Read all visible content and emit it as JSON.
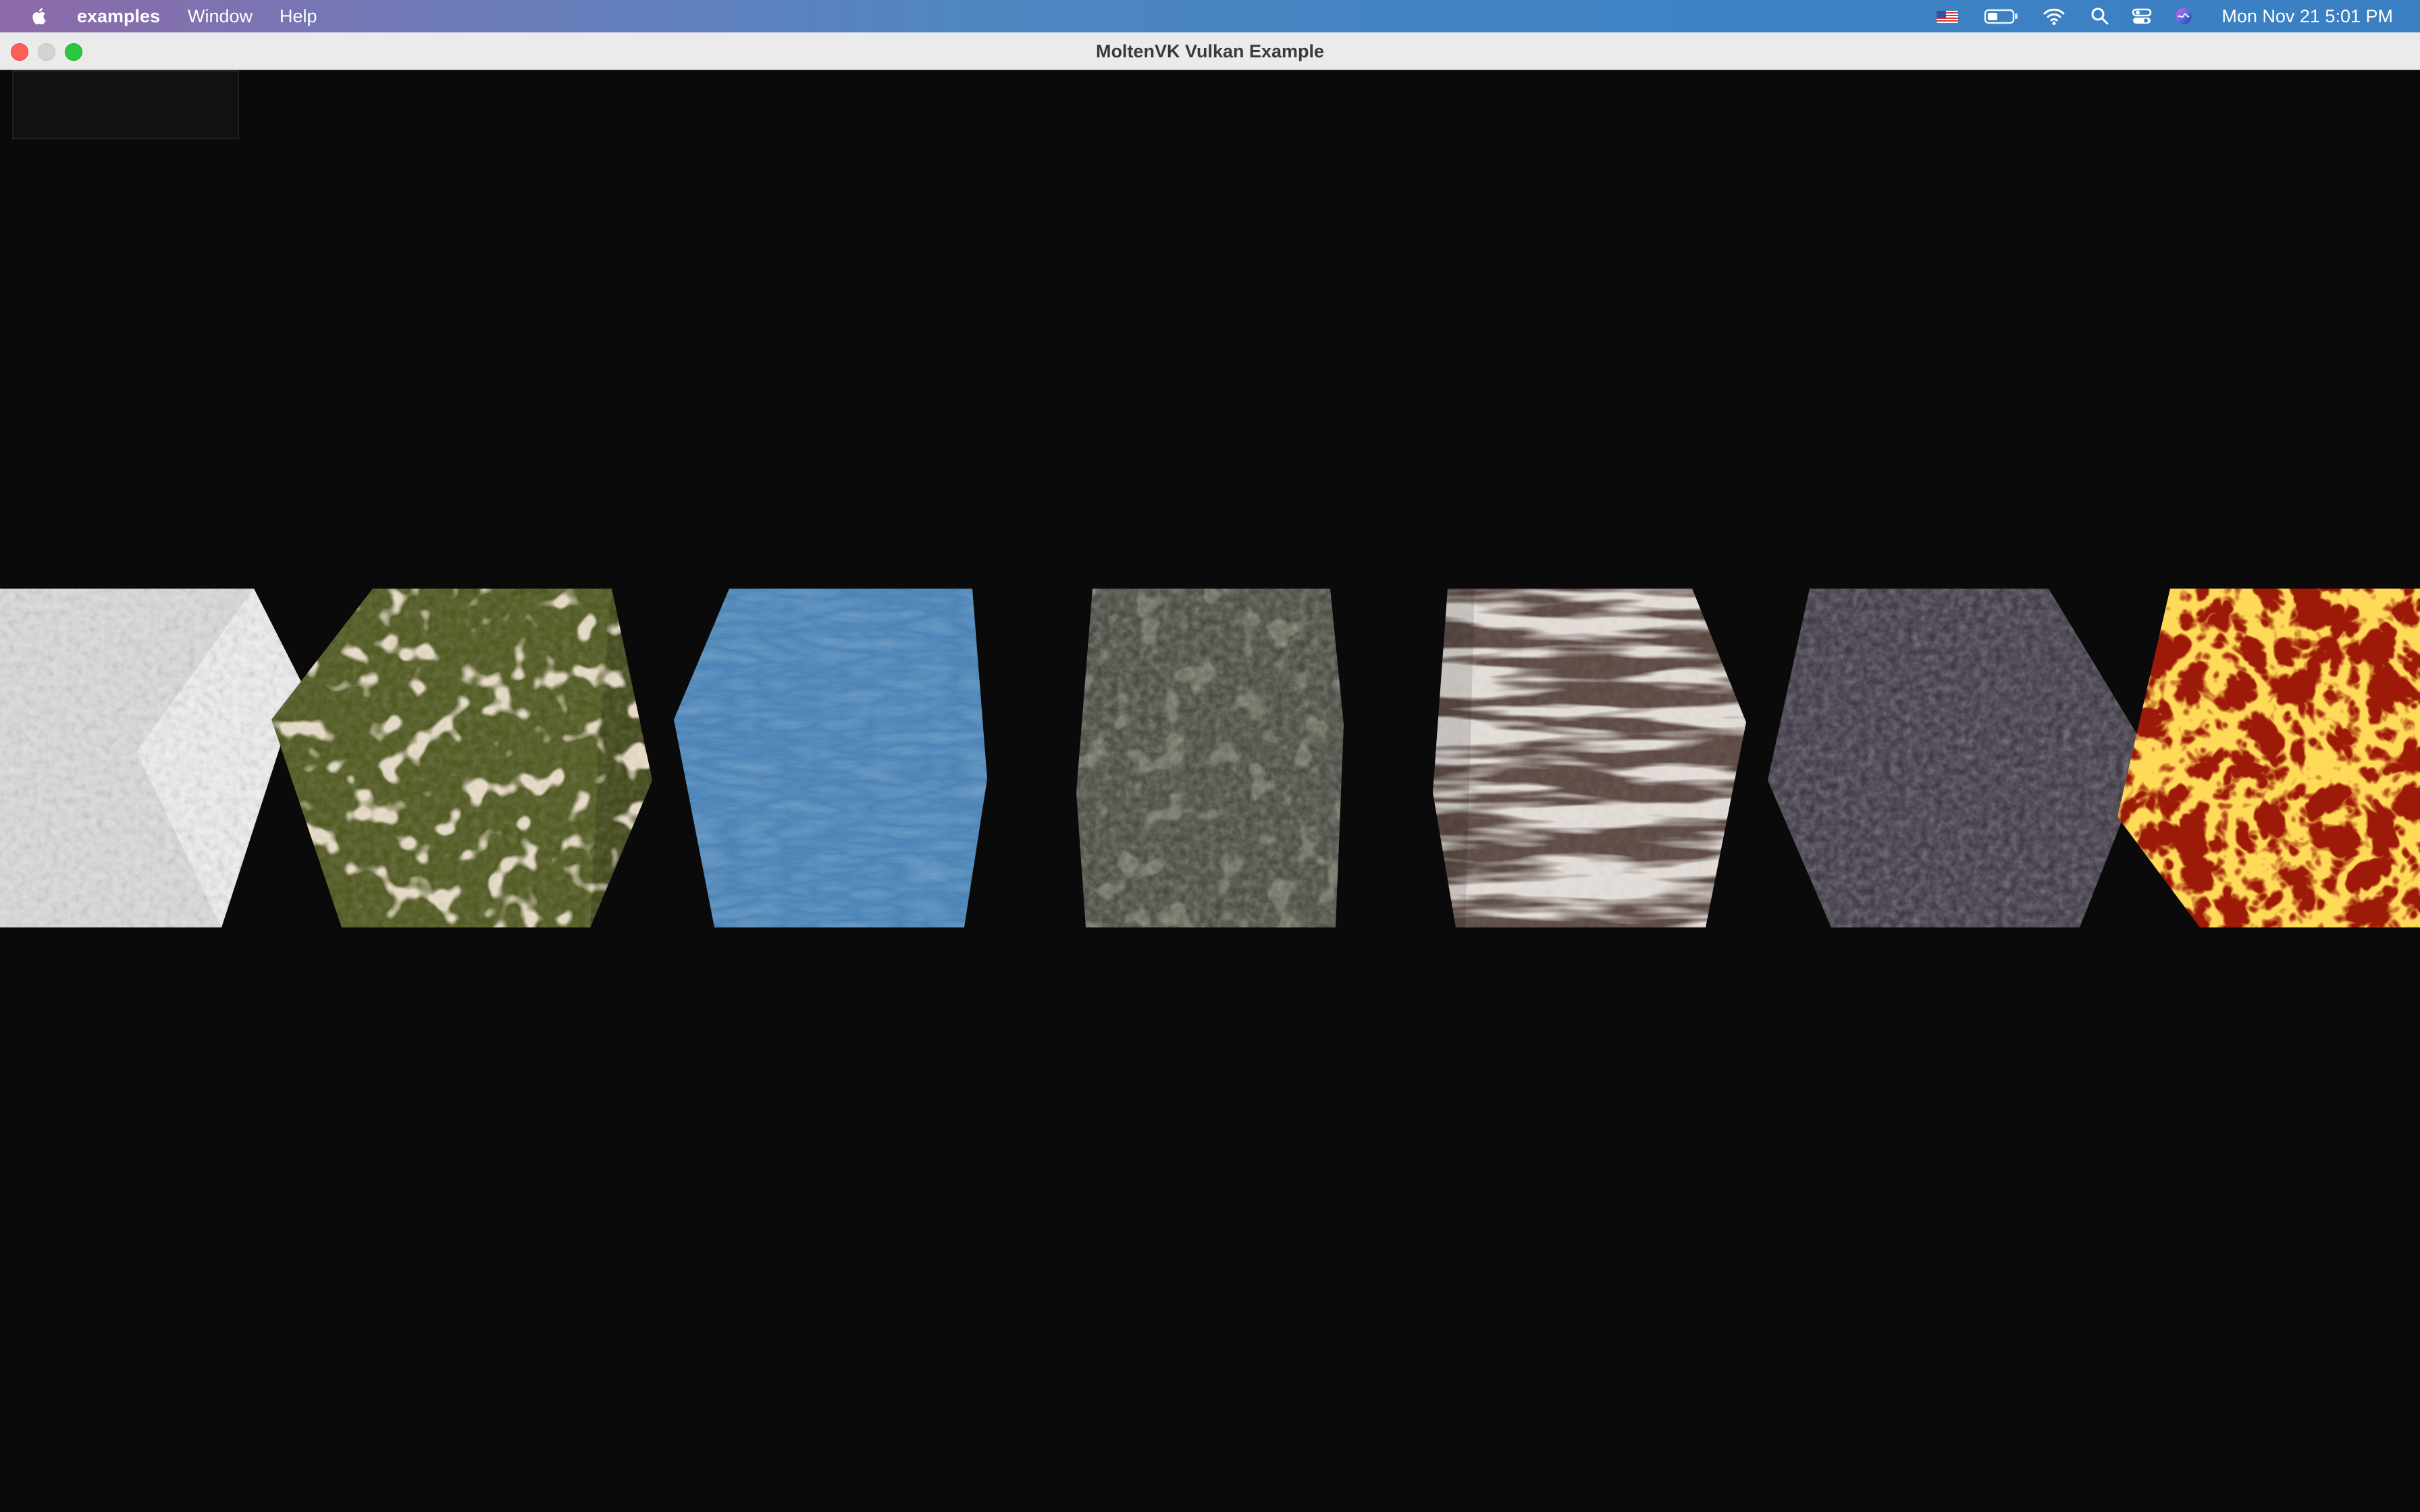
{
  "menubar": {
    "apple_icon": "apple-logo-icon",
    "app_name": "examples",
    "items": [
      "Window",
      "Help"
    ],
    "status_icons": [
      "us-flag-input-icon",
      "battery-icon",
      "wifi-icon",
      "spotlight-search-icon",
      "control-center-icon",
      "siri-icon"
    ],
    "clock": "Mon Nov 21  5:01 PM"
  },
  "window": {
    "title": "MoltenVK Vulkan Example",
    "buttons": [
      "close",
      "minimize",
      "zoom"
    ]
  },
  "scene": {
    "background": "#0a0a0a",
    "cubes": [
      {
        "texture": "white-marble",
        "color": "#d9d9d9"
      },
      {
        "texture": "grass-moss",
        "color": "#4f5a1c"
      },
      {
        "texture": "water",
        "color": "#4a84b8"
      },
      {
        "texture": "rocky-ground",
        "color": "#3d4236"
      },
      {
        "texture": "striped-rock",
        "color": "#6e5a50"
      },
      {
        "texture": "dark-speckled-stone",
        "color": "#3a3444"
      },
      {
        "texture": "lava",
        "color": "#c8240a"
      }
    ]
  }
}
